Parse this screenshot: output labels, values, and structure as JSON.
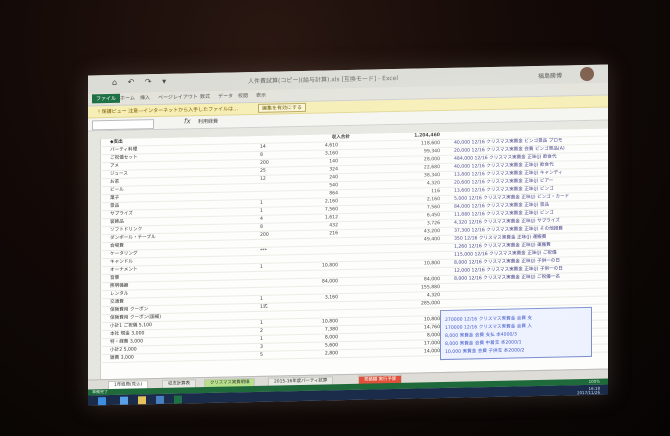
{
  "window": {
    "title": "人件費試算(コピー)(給与計算).xls [互換モード] - Excel",
    "user": "福島勝博",
    "quick_access": "⌂ ↶ ↷ ▾"
  },
  "ribbon": {
    "tabs": [
      "ファイル",
      "ホーム",
      "挿入",
      "ページレイアウト",
      "数式",
      "データ",
      "校閲",
      "表示"
    ]
  },
  "notice": {
    "text": "! 保護ビュー 注意—インターネットから入手したファイルは…",
    "button": "編集を有効にする"
  },
  "formula_bar": {
    "fx": "fx",
    "content": "利用経費"
  },
  "sheet": {
    "header_row": {
      "name": "◆支出",
      "label": "収入合計",
      "total": "1,204,460"
    },
    "rows": [
      {
        "name": "パーティ料理",
        "unit": "14",
        "qty": "4,610",
        "amt": "",
        "tot": "118,600",
        "r1": "40,000 12/16 クリスマス実費金 ビンゴ景品 プロモ"
      },
      {
        "name": "ご祝儀セット",
        "unit": "8",
        "qty": "3,160",
        "amt": "",
        "tot": "99,340",
        "r1": "20,000 12/16 クリスマス実費金 会費 ビンゴ景品(A)"
      },
      {
        "name": "アメ",
        "unit": "200",
        "qty": "140",
        "amt": "",
        "tot": "28,000",
        "r1": "484,000 12/16 クリスマス実費金 正味(J) 飲食代"
      },
      {
        "name": "ジュース",
        "unit": "25",
        "qty": "324",
        "amt": "",
        "tot": "22,680",
        "r1": "40,000 12/16 クリスマス実費金 正味(J) 飲食代"
      },
      {
        "name": "お茶",
        "unit": "12",
        "qty": "240",
        "amt": "",
        "tot": "38,340",
        "r1": "13,800 12/16 クリスマス実費金 正味(J) キャンディ"
      },
      {
        "name": "ビール",
        "unit": "",
        "qty": "540",
        "amt": "",
        "tot": "4,320",
        "r1": "20,600 12/16 クリスマス実費金 正味(J) ビアー"
      },
      {
        "name": "菓子",
        "unit": "",
        "qty": "864",
        "amt": "",
        "tot": "116",
        "r1": "13,600 12/16 クリスマス実費金 正味(J) ビンゴ"
      },
      {
        "name": "景品",
        "unit": "1",
        "qty": "2,160",
        "amt": "",
        "tot": "2,160",
        "r1": "5,000 12/16 クリスマス実費金 正味(J) ビンゴ・カード"
      },
      {
        "name": "サプライズ",
        "unit": "1",
        "qty": "7,560",
        "amt": "",
        "tot": "7,560",
        "r1": "84,000 12/16 クリスマス実費金 正味(J) 景品"
      },
      {
        "name": "装飾品",
        "unit": "4",
        "qty": "1,612",
        "amt": "",
        "tot": "6,450",
        "r1": "11,880 12/16 クリスマス実費金 正味(J) ビンゴ"
      },
      {
        "name": "ソフトドリンク",
        "unit": "8",
        "qty": "432",
        "amt": "",
        "tot": "3,726",
        "r1": "4,320 12/16 クリスマス実費金 正味(J) サプライズ"
      },
      {
        "name": "ダンボール・テーブル",
        "unit": "200",
        "qty": "216",
        "amt": "",
        "tot": "43,200",
        "r1": "37,300 12/16 クリスマス実費金 正味(J) その他雑費"
      },
      {
        "name": "会場費",
        "unit": "",
        "qty": "",
        "amt": "",
        "tot": "49,400",
        "r1": "350 12/16 クリスマス実費金 正味(J) 運搬費"
      },
      {
        "name": "ケータリング",
        "unit": "***",
        "qty": "",
        "amt": "",
        "tot": "",
        "r1": "1,260 12/16 クリスマス実費金 正味(J) 運搬費"
      },
      {
        "name": "キャンドル",
        "unit": "",
        "qty": "",
        "amt": "",
        "tot": "",
        "r1": "115,000 12/16 クリスマス実費金 正味(J) ご祝儀"
      },
      {
        "name": "オーナメント",
        "unit": "1",
        "qty": "10,800",
        "amt": "",
        "tot": "10,800",
        "r1": "8,000 12/16 クリスマス実費金 正味(J) 子供一の日"
      },
      {
        "name": "音響",
        "unit": "",
        "qty": "",
        "amt": "",
        "tot": "",
        "r1": "12,000 12/16 クリスマス実費金 正味(J) 子供一の日"
      },
      {
        "name": "照明機器",
        "unit": "",
        "qty": "84,000",
        "amt": "",
        "tot": "84,000",
        "r1": "8,000 12/16 クリスマス実費金 正味(J) ご祝儀一名"
      },
      {
        "name": "レンタル",
        "unit": "",
        "qty": "",
        "amt": "",
        "tot": "155,880",
        "r1": ""
      },
      {
        "name": "交通費",
        "unit": "1",
        "qty": "3,160",
        "amt": "",
        "tot": "4,320",
        "r1": ""
      },
      {
        "name": "保険費用 クーポン",
        "unit": "1式",
        "qty": "",
        "amt": "",
        "tot": "285,000",
        "r1": ""
      },
      {
        "name": "保険費用 クーポン(国補)",
        "unit": "",
        "qty": "",
        "amt": "",
        "tot": "",
        "r1": ""
      },
      {
        "name": "小計1  ご祝儀  5,100",
        "unit": "1",
        "qty": "10,800",
        "amt": "",
        "tot": "10,800",
        "r1": ""
      },
      {
        "name": "本社  現金  3,000",
        "unit": "2",
        "qty": "7,380",
        "amt": "",
        "tot": "14,760",
        "r1": ""
      },
      {
        "name": "特・経費  3,000",
        "unit": "1",
        "qty": "8,000",
        "amt": "",
        "tot": "8,000",
        "r1": ""
      },
      {
        "name": "小計2  5,000",
        "unit": "3",
        "qty": "5,600",
        "amt": "",
        "tot": "17,000",
        "r1": ""
      },
      {
        "name": "雑費  3,000",
        "unit": "5",
        "qty": "2,800",
        "amt": "",
        "tot": "14,000",
        "r1": ""
      }
    ]
  },
  "summary_panel": {
    "lines": [
      "270000 12/16 クリスマス実費金 会費 支",
      "170000 12/16 クリスマス実費金 会費 入",
      "8,000 実費金 会費 支払 本4000/3",
      "8,000 実費金 会費 中着支 本2000/1",
      "10,000 実費金 会費 子供支 本2000/2"
    ]
  },
  "sheet_tabs": [
    "1年経費(見込)",
    "収支計算表",
    "クリスマス実費明細",
    "2015-16年度パーティ試算",
    "見積額 実行予算"
  ],
  "status": "準備完了",
  "zoom": "100%",
  "clock": {
    "time": "16:18",
    "date": "2017/11/26"
  },
  "colors": {
    "excel_green": "#1e7145",
    "panel_blue": "#3c55c8",
    "notice_yellow": "#f6eeb4"
  }
}
